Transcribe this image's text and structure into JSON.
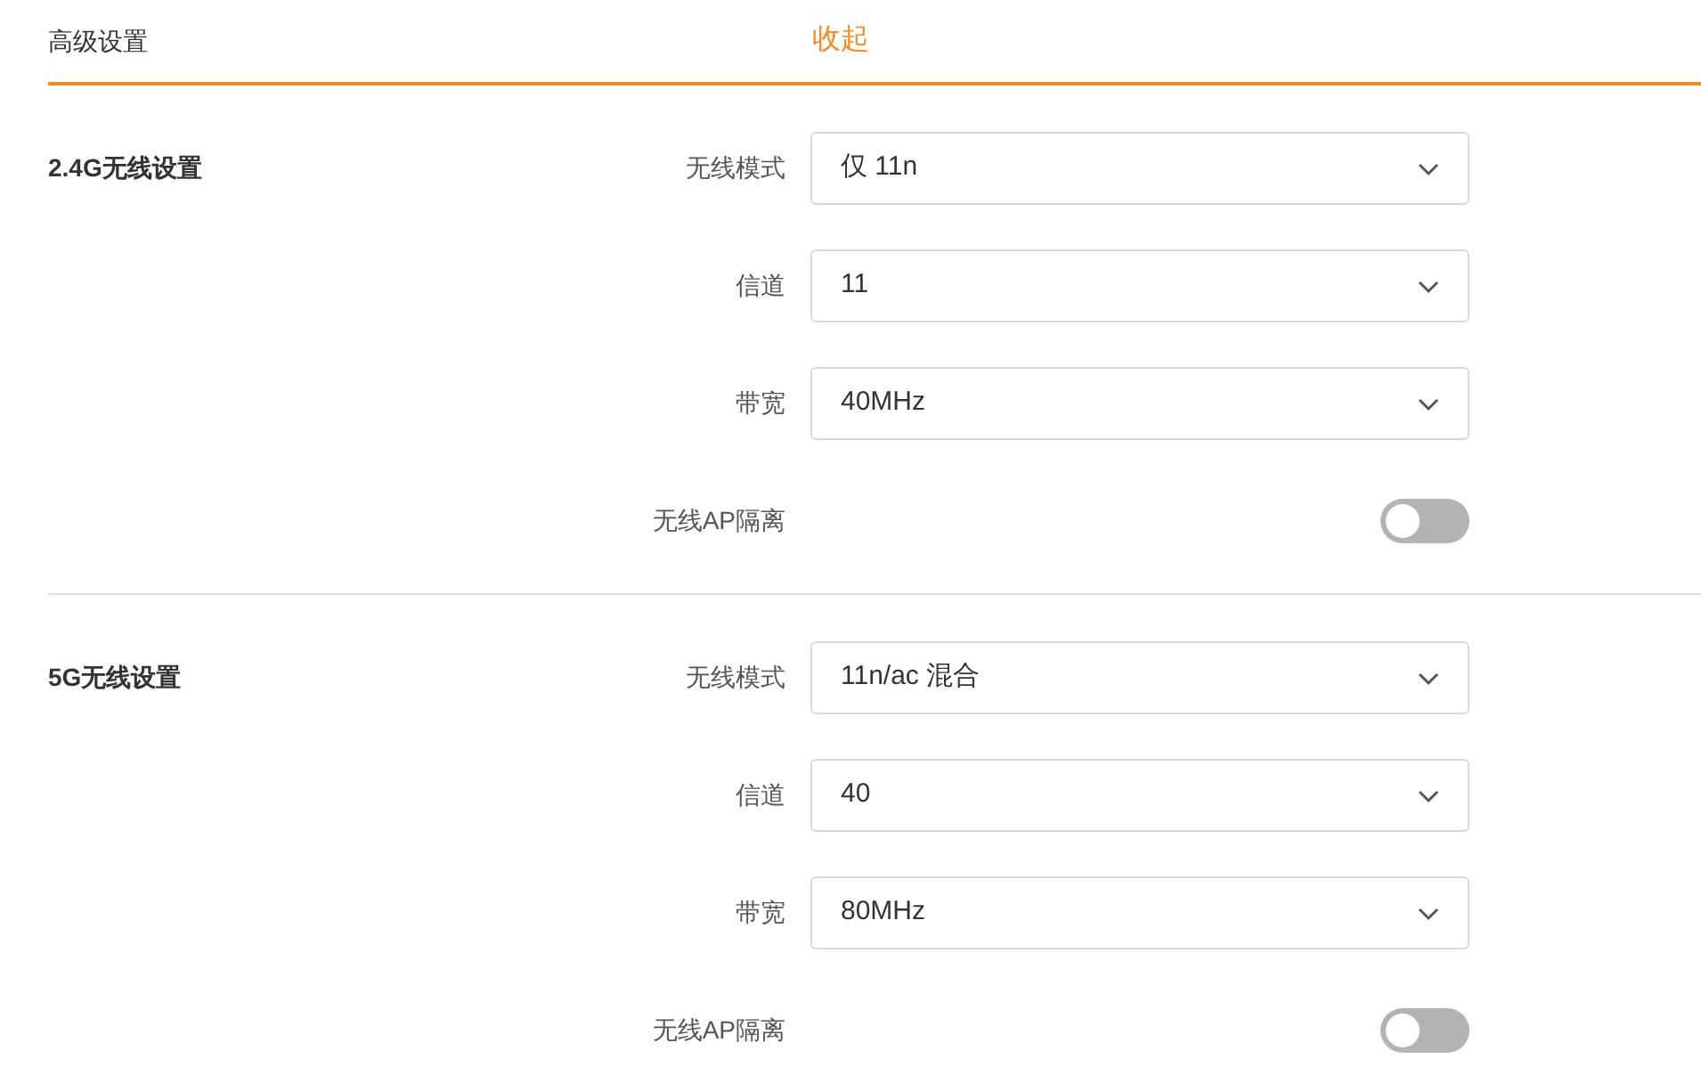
{
  "header": {
    "title": "高级设置",
    "collapse_link": "收起"
  },
  "sections": [
    {
      "title": "2.4G无线设置",
      "fields": [
        {
          "kind": "select",
          "label": "无线模式",
          "value": "仅 11n"
        },
        {
          "kind": "select",
          "label": "信道",
          "value": "11"
        },
        {
          "kind": "select",
          "label": "带宽",
          "value": "40MHz"
        },
        {
          "kind": "toggle",
          "label": "无线AP隔离",
          "on": false
        }
      ]
    },
    {
      "title": "5G无线设置",
      "fields": [
        {
          "kind": "select",
          "label": "无线模式",
          "value": "11n/ac 混合"
        },
        {
          "kind": "select",
          "label": "信道",
          "value": "40"
        },
        {
          "kind": "select",
          "label": "带宽",
          "value": "80MHz"
        },
        {
          "kind": "toggle",
          "label": "无线AP隔离",
          "on": false
        }
      ]
    }
  ]
}
